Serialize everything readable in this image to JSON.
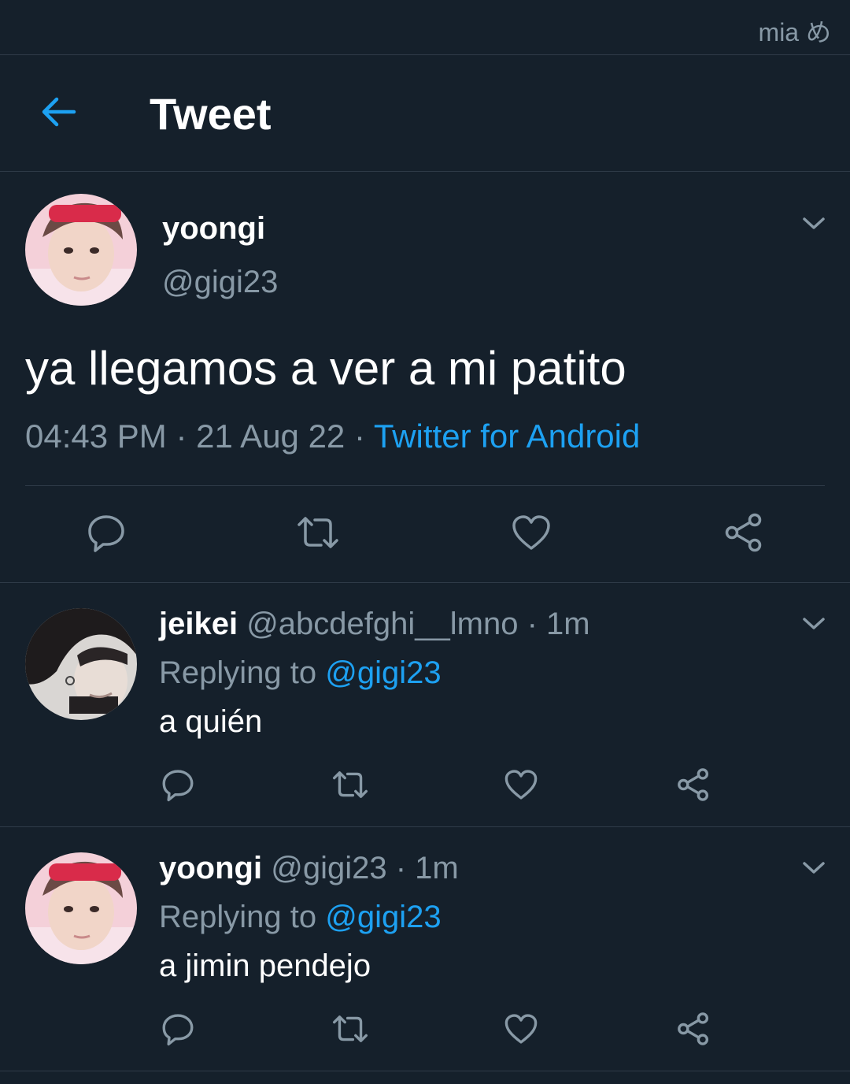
{
  "status": {
    "watermark": "mia め"
  },
  "header": {
    "title": "Tweet"
  },
  "tweet": {
    "name": "yoongi",
    "handle": "@gigi23",
    "text": "ya llegamos a ver a mi patito",
    "time": "04:43 PM",
    "date": "21 Aug 22",
    "source": "Twitter for Android"
  },
  "replies": [
    {
      "name": "jeikei",
      "handle": "@abcdefghi__lmno",
      "time": "1m",
      "replying_label": "Replying to",
      "mention": "@gigi23",
      "text": "a quién"
    },
    {
      "name": "yoongi",
      "handle": "@gigi23",
      "time": "1m",
      "replying_label": "Replying to",
      "mention": "@gigi23",
      "text": "a jimin pendejo"
    }
  ],
  "colors": {
    "background": "#15202b",
    "accent": "#1da1f2",
    "muted": "#8899a6",
    "divider": "#2f3b48"
  },
  "icons": [
    "back-arrow-icon",
    "chevron-down-icon",
    "reply-icon",
    "retweet-icon",
    "like-icon",
    "share-icon"
  ]
}
